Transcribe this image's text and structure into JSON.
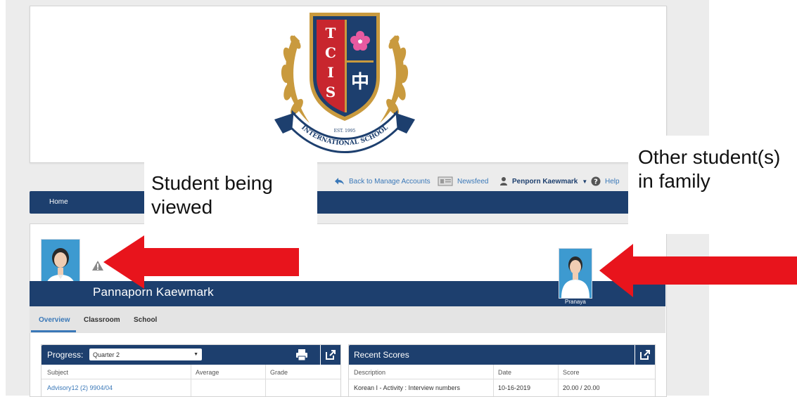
{
  "logo": {
    "letters": [
      "T",
      "C",
      "I",
      "S"
    ],
    "chinese_char": "中",
    "est": "EST. 1995",
    "banner": "INTERNATIONAL SCHOOL"
  },
  "toplinks": {
    "back": "Back to Manage Accounts",
    "newsfeed": "Newsfeed",
    "user": "Penporn Kaewmark",
    "help": "Help"
  },
  "nav": {
    "home": "Home"
  },
  "student": {
    "name": "Pannaporn Kaewmark",
    "sibling_name": "Pranaya"
  },
  "tabs": [
    "Overview",
    "Classroom",
    "School"
  ],
  "progress": {
    "title": "Progress:",
    "quarter": "Quarter 2",
    "columns": [
      "Subject",
      "Average",
      "Grade"
    ],
    "rows": [
      {
        "subject": "Advisory12 (2) 9904/04",
        "average": "",
        "grade": ""
      }
    ]
  },
  "recent_scores": {
    "title": "Recent Scores",
    "columns": [
      "Description",
      "Date",
      "Score"
    ],
    "rows": [
      {
        "description": "Korean I - Activity : Interview numbers",
        "date": "10-16-2019",
        "score": "20.00 / 20.00"
      }
    ]
  },
  "annotations": {
    "student_viewed": "Student being viewed",
    "other_students": "Other student(s) in family"
  },
  "colors": {
    "navy": "#1d3f6e",
    "link_blue": "#3a78b8",
    "arrow_red": "#e8141c",
    "shield_red": "#c8262e",
    "gold": "#c99a3e"
  }
}
